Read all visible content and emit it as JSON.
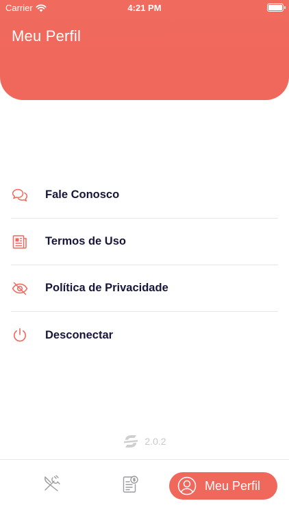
{
  "status_bar": {
    "carrier": "Carrier",
    "time": "4:21 PM"
  },
  "header": {
    "title": "Meu Perfil"
  },
  "menu": {
    "items": [
      {
        "label": "Fale Conosco",
        "icon": "chat-bubbles-icon"
      },
      {
        "label": "Termos de Uso",
        "icon": "document-icon"
      },
      {
        "label": "Política de Privacidade",
        "icon": "eye-off-icon"
      },
      {
        "label": "Desconectar",
        "icon": "power-icon"
      }
    ]
  },
  "footer": {
    "version": "2.0.2"
  },
  "tabbar": {
    "profile_label": "Meu Perfil"
  },
  "colors": {
    "accent": "#f0675c",
    "text_dark": "#16163a",
    "divider": "#e6e6e6",
    "muted": "#c8c8c8"
  }
}
